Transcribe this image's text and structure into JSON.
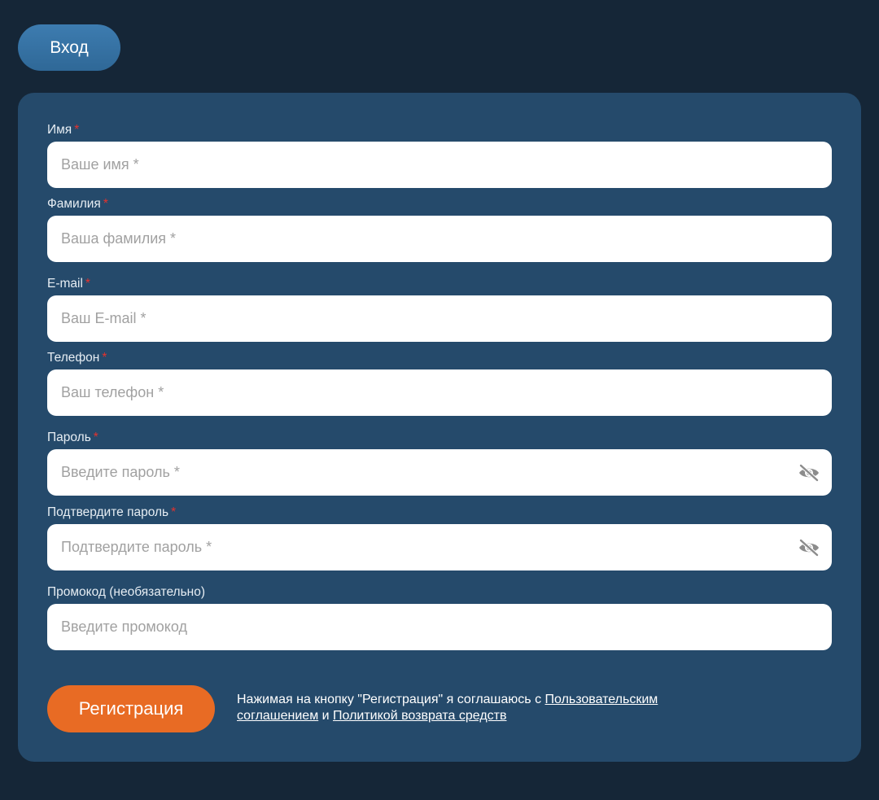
{
  "header": {
    "login_label": "Вход"
  },
  "form": {
    "required_mark": "*",
    "fields": {
      "first_name": {
        "label": "Имя",
        "placeholder": "Ваше имя *"
      },
      "last_name": {
        "label": "Фамилия",
        "placeholder": "Ваша фамилия *"
      },
      "email": {
        "label": "E-mail",
        "placeholder": "Ваш E-mail *"
      },
      "phone": {
        "label": "Телефон",
        "placeholder": "Ваш телефон *"
      },
      "password": {
        "label": "Пароль",
        "placeholder": "Введите пароль *"
      },
      "password_confirm": {
        "label": "Подтвердите пароль",
        "placeholder": "Подтвердите пароль *"
      },
      "promo": {
        "label": "Промокод (необязательно)",
        "placeholder": "Введите промокод"
      }
    },
    "submit_label": "Регистрация",
    "agreement": {
      "prefix": "Нажимая на кнопку \"Регистрация\" я соглашаюсь с ",
      "user_agreement_link": "Пользовательским соглашением",
      "conjunction": " и ",
      "refund_policy_link": "Политикой возврата средств"
    }
  },
  "colors": {
    "background": "#152637",
    "card": "#254a6b",
    "login_button": "#3a76a8",
    "submit_button": "#e86b24",
    "required_mark": "#e5322d"
  },
  "icons": {
    "password_toggle": "eye-slash-icon"
  }
}
